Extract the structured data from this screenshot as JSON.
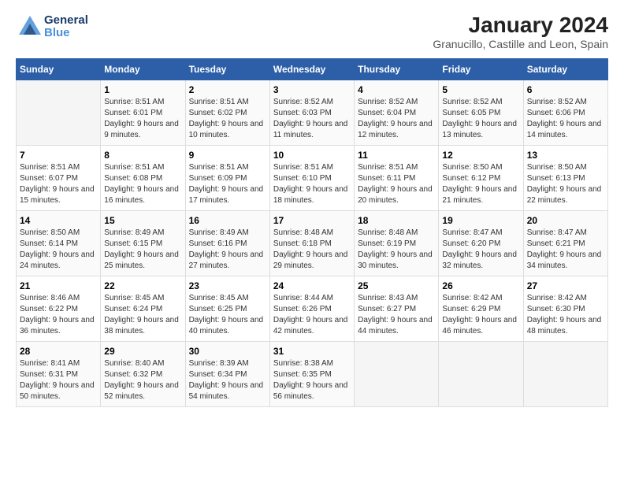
{
  "logo": {
    "line1": "General",
    "line2": "Blue"
  },
  "title": "January 2024",
  "subtitle": "Granucillo, Castille and Leon, Spain",
  "days_header": [
    "Sunday",
    "Monday",
    "Tuesday",
    "Wednesday",
    "Thursday",
    "Friday",
    "Saturday"
  ],
  "weeks": [
    [
      {
        "day": "",
        "sunrise": "",
        "sunset": "",
        "daylight": ""
      },
      {
        "day": "1",
        "sunrise": "Sunrise: 8:51 AM",
        "sunset": "Sunset: 6:01 PM",
        "daylight": "Daylight: 9 hours and 9 minutes."
      },
      {
        "day": "2",
        "sunrise": "Sunrise: 8:51 AM",
        "sunset": "Sunset: 6:02 PM",
        "daylight": "Daylight: 9 hours and 10 minutes."
      },
      {
        "day": "3",
        "sunrise": "Sunrise: 8:52 AM",
        "sunset": "Sunset: 6:03 PM",
        "daylight": "Daylight: 9 hours and 11 minutes."
      },
      {
        "day": "4",
        "sunrise": "Sunrise: 8:52 AM",
        "sunset": "Sunset: 6:04 PM",
        "daylight": "Daylight: 9 hours and 12 minutes."
      },
      {
        "day": "5",
        "sunrise": "Sunrise: 8:52 AM",
        "sunset": "Sunset: 6:05 PM",
        "daylight": "Daylight: 9 hours and 13 minutes."
      },
      {
        "day": "6",
        "sunrise": "Sunrise: 8:52 AM",
        "sunset": "Sunset: 6:06 PM",
        "daylight": "Daylight: 9 hours and 14 minutes."
      }
    ],
    [
      {
        "day": "7",
        "sunrise": "Sunrise: 8:51 AM",
        "sunset": "Sunset: 6:07 PM",
        "daylight": "Daylight: 9 hours and 15 minutes."
      },
      {
        "day": "8",
        "sunrise": "Sunrise: 8:51 AM",
        "sunset": "Sunset: 6:08 PM",
        "daylight": "Daylight: 9 hours and 16 minutes."
      },
      {
        "day": "9",
        "sunrise": "Sunrise: 8:51 AM",
        "sunset": "Sunset: 6:09 PM",
        "daylight": "Daylight: 9 hours and 17 minutes."
      },
      {
        "day": "10",
        "sunrise": "Sunrise: 8:51 AM",
        "sunset": "Sunset: 6:10 PM",
        "daylight": "Daylight: 9 hours and 18 minutes."
      },
      {
        "day": "11",
        "sunrise": "Sunrise: 8:51 AM",
        "sunset": "Sunset: 6:11 PM",
        "daylight": "Daylight: 9 hours and 20 minutes."
      },
      {
        "day": "12",
        "sunrise": "Sunrise: 8:50 AM",
        "sunset": "Sunset: 6:12 PM",
        "daylight": "Daylight: 9 hours and 21 minutes."
      },
      {
        "day": "13",
        "sunrise": "Sunrise: 8:50 AM",
        "sunset": "Sunset: 6:13 PM",
        "daylight": "Daylight: 9 hours and 22 minutes."
      }
    ],
    [
      {
        "day": "14",
        "sunrise": "Sunrise: 8:50 AM",
        "sunset": "Sunset: 6:14 PM",
        "daylight": "Daylight: 9 hours and 24 minutes."
      },
      {
        "day": "15",
        "sunrise": "Sunrise: 8:49 AM",
        "sunset": "Sunset: 6:15 PM",
        "daylight": "Daylight: 9 hours and 25 minutes."
      },
      {
        "day": "16",
        "sunrise": "Sunrise: 8:49 AM",
        "sunset": "Sunset: 6:16 PM",
        "daylight": "Daylight: 9 hours and 27 minutes."
      },
      {
        "day": "17",
        "sunrise": "Sunrise: 8:48 AM",
        "sunset": "Sunset: 6:18 PM",
        "daylight": "Daylight: 9 hours and 29 minutes."
      },
      {
        "day": "18",
        "sunrise": "Sunrise: 8:48 AM",
        "sunset": "Sunset: 6:19 PM",
        "daylight": "Daylight: 9 hours and 30 minutes."
      },
      {
        "day": "19",
        "sunrise": "Sunrise: 8:47 AM",
        "sunset": "Sunset: 6:20 PM",
        "daylight": "Daylight: 9 hours and 32 minutes."
      },
      {
        "day": "20",
        "sunrise": "Sunrise: 8:47 AM",
        "sunset": "Sunset: 6:21 PM",
        "daylight": "Daylight: 9 hours and 34 minutes."
      }
    ],
    [
      {
        "day": "21",
        "sunrise": "Sunrise: 8:46 AM",
        "sunset": "Sunset: 6:22 PM",
        "daylight": "Daylight: 9 hours and 36 minutes."
      },
      {
        "day": "22",
        "sunrise": "Sunrise: 8:45 AM",
        "sunset": "Sunset: 6:24 PM",
        "daylight": "Daylight: 9 hours and 38 minutes."
      },
      {
        "day": "23",
        "sunrise": "Sunrise: 8:45 AM",
        "sunset": "Sunset: 6:25 PM",
        "daylight": "Daylight: 9 hours and 40 minutes."
      },
      {
        "day": "24",
        "sunrise": "Sunrise: 8:44 AM",
        "sunset": "Sunset: 6:26 PM",
        "daylight": "Daylight: 9 hours and 42 minutes."
      },
      {
        "day": "25",
        "sunrise": "Sunrise: 8:43 AM",
        "sunset": "Sunset: 6:27 PM",
        "daylight": "Daylight: 9 hours and 44 minutes."
      },
      {
        "day": "26",
        "sunrise": "Sunrise: 8:42 AM",
        "sunset": "Sunset: 6:29 PM",
        "daylight": "Daylight: 9 hours and 46 minutes."
      },
      {
        "day": "27",
        "sunrise": "Sunrise: 8:42 AM",
        "sunset": "Sunset: 6:30 PM",
        "daylight": "Daylight: 9 hours and 48 minutes."
      }
    ],
    [
      {
        "day": "28",
        "sunrise": "Sunrise: 8:41 AM",
        "sunset": "Sunset: 6:31 PM",
        "daylight": "Daylight: 9 hours and 50 minutes."
      },
      {
        "day": "29",
        "sunrise": "Sunrise: 8:40 AM",
        "sunset": "Sunset: 6:32 PM",
        "daylight": "Daylight: 9 hours and 52 minutes."
      },
      {
        "day": "30",
        "sunrise": "Sunrise: 8:39 AM",
        "sunset": "Sunset: 6:34 PM",
        "daylight": "Daylight: 9 hours and 54 minutes."
      },
      {
        "day": "31",
        "sunrise": "Sunrise: 8:38 AM",
        "sunset": "Sunset: 6:35 PM",
        "daylight": "Daylight: 9 hours and 56 minutes."
      },
      {
        "day": "",
        "sunrise": "",
        "sunset": "",
        "daylight": ""
      },
      {
        "day": "",
        "sunrise": "",
        "sunset": "",
        "daylight": ""
      },
      {
        "day": "",
        "sunrise": "",
        "sunset": "",
        "daylight": ""
      }
    ]
  ]
}
